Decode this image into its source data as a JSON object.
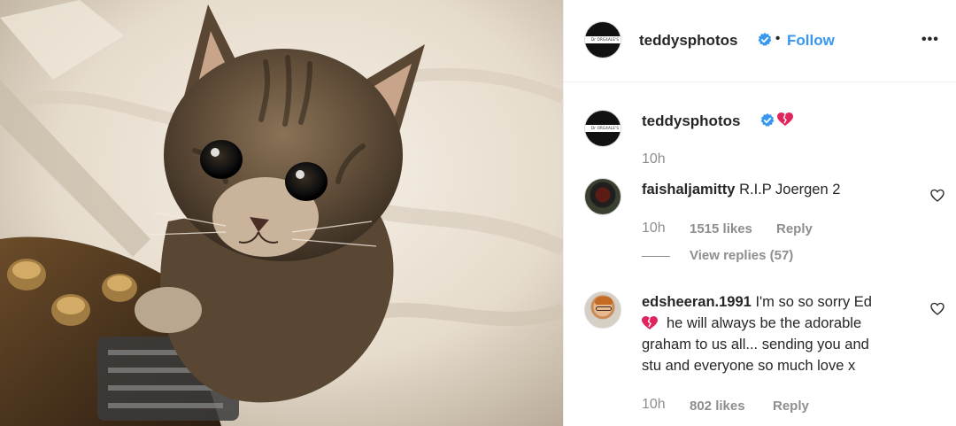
{
  "post": {
    "photo_subject": "kitten-photo",
    "author": "teddysphotos",
    "follow_label": "Follow",
    "separator": "•",
    "more_label": "•••",
    "avatar_text": "Dr ORG4ALE'S"
  },
  "caption": {
    "username": "teddysphotos",
    "emoji": "broken-heart",
    "time": "10h"
  },
  "comments": [
    {
      "username": "faishaljamitty",
      "text": "R.I.P Joergen 2",
      "time": "10h",
      "likes": "1515 likes",
      "reply": "Reply",
      "view_replies": "View replies (57)"
    },
    {
      "username": "edsheeran.1991",
      "text_line1": "I'm so so sorry Ed",
      "text_line2": "he will always be the adorable",
      "text_line3": "graham to us all... sending you and",
      "text_line4": "stu and everyone so much love x",
      "time": "10h",
      "likes": "802 likes",
      "reply": "Reply"
    }
  ],
  "colors": {
    "link": "#3897f0",
    "verified": "#3897f0",
    "muted": "#8e8e8e",
    "text": "#262626",
    "broken_heart": "#e0245e"
  }
}
